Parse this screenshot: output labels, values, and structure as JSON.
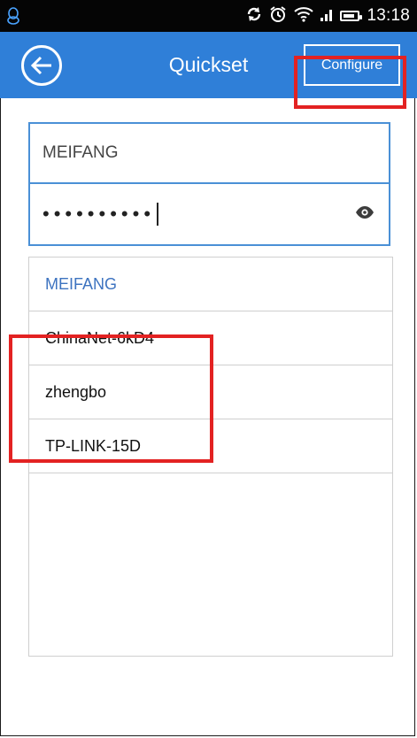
{
  "status_bar": {
    "left_icon": "qq-penguin-icon",
    "icons": [
      "sync-icon",
      "alarm-icon",
      "wifi-icon",
      "signal-icon",
      "battery-icon"
    ],
    "time": "13:18"
  },
  "app_bar": {
    "back_icon": "back-arrow-icon",
    "title": "Quickset",
    "configure_label": "Configure",
    "color": "#2f7fd8"
  },
  "form": {
    "ssid_value": "MEIFANG",
    "password_masked": "••••••••••",
    "show_password_icon": "eye-icon"
  },
  "network_list": {
    "items": [
      {
        "label": "MEIFANG",
        "selected": true
      },
      {
        "label": "ChinaNet-6kD4",
        "selected": false
      },
      {
        "label": "zhengbo",
        "selected": false
      },
      {
        "label": "TP-LINK-15D",
        "selected": false
      }
    ],
    "selected_color": "#3d73c0"
  },
  "annotations": {
    "highlight_color": "#e32222"
  }
}
